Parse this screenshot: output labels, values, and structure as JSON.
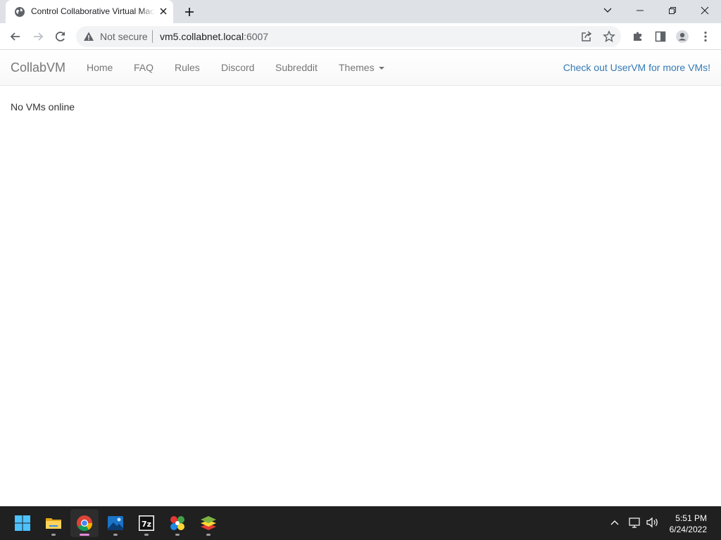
{
  "browser": {
    "tab_title": "Control Collaborative Virtual Machines",
    "security_label": "Not secure",
    "url_host": "vm5.collabnet.local",
    "url_port": ":6007"
  },
  "navbar": {
    "brand": "CollabVM",
    "links": [
      "Home",
      "FAQ",
      "Rules",
      "Discord",
      "Subreddit"
    ],
    "themes_label": "Themes",
    "right_link": "Check out UserVM for more VMs!"
  },
  "content": {
    "message": "No VMs online"
  },
  "taskbar": {
    "apps": [
      "start",
      "file-explorer",
      "chrome",
      "photos",
      "7zip",
      "app-colorful",
      "app-stack"
    ],
    "time": "5:51 PM",
    "date": "6/24/2022"
  },
  "colors": {
    "link": "#337ab7",
    "nav_text": "#777777",
    "taskbar": "#202020"
  }
}
